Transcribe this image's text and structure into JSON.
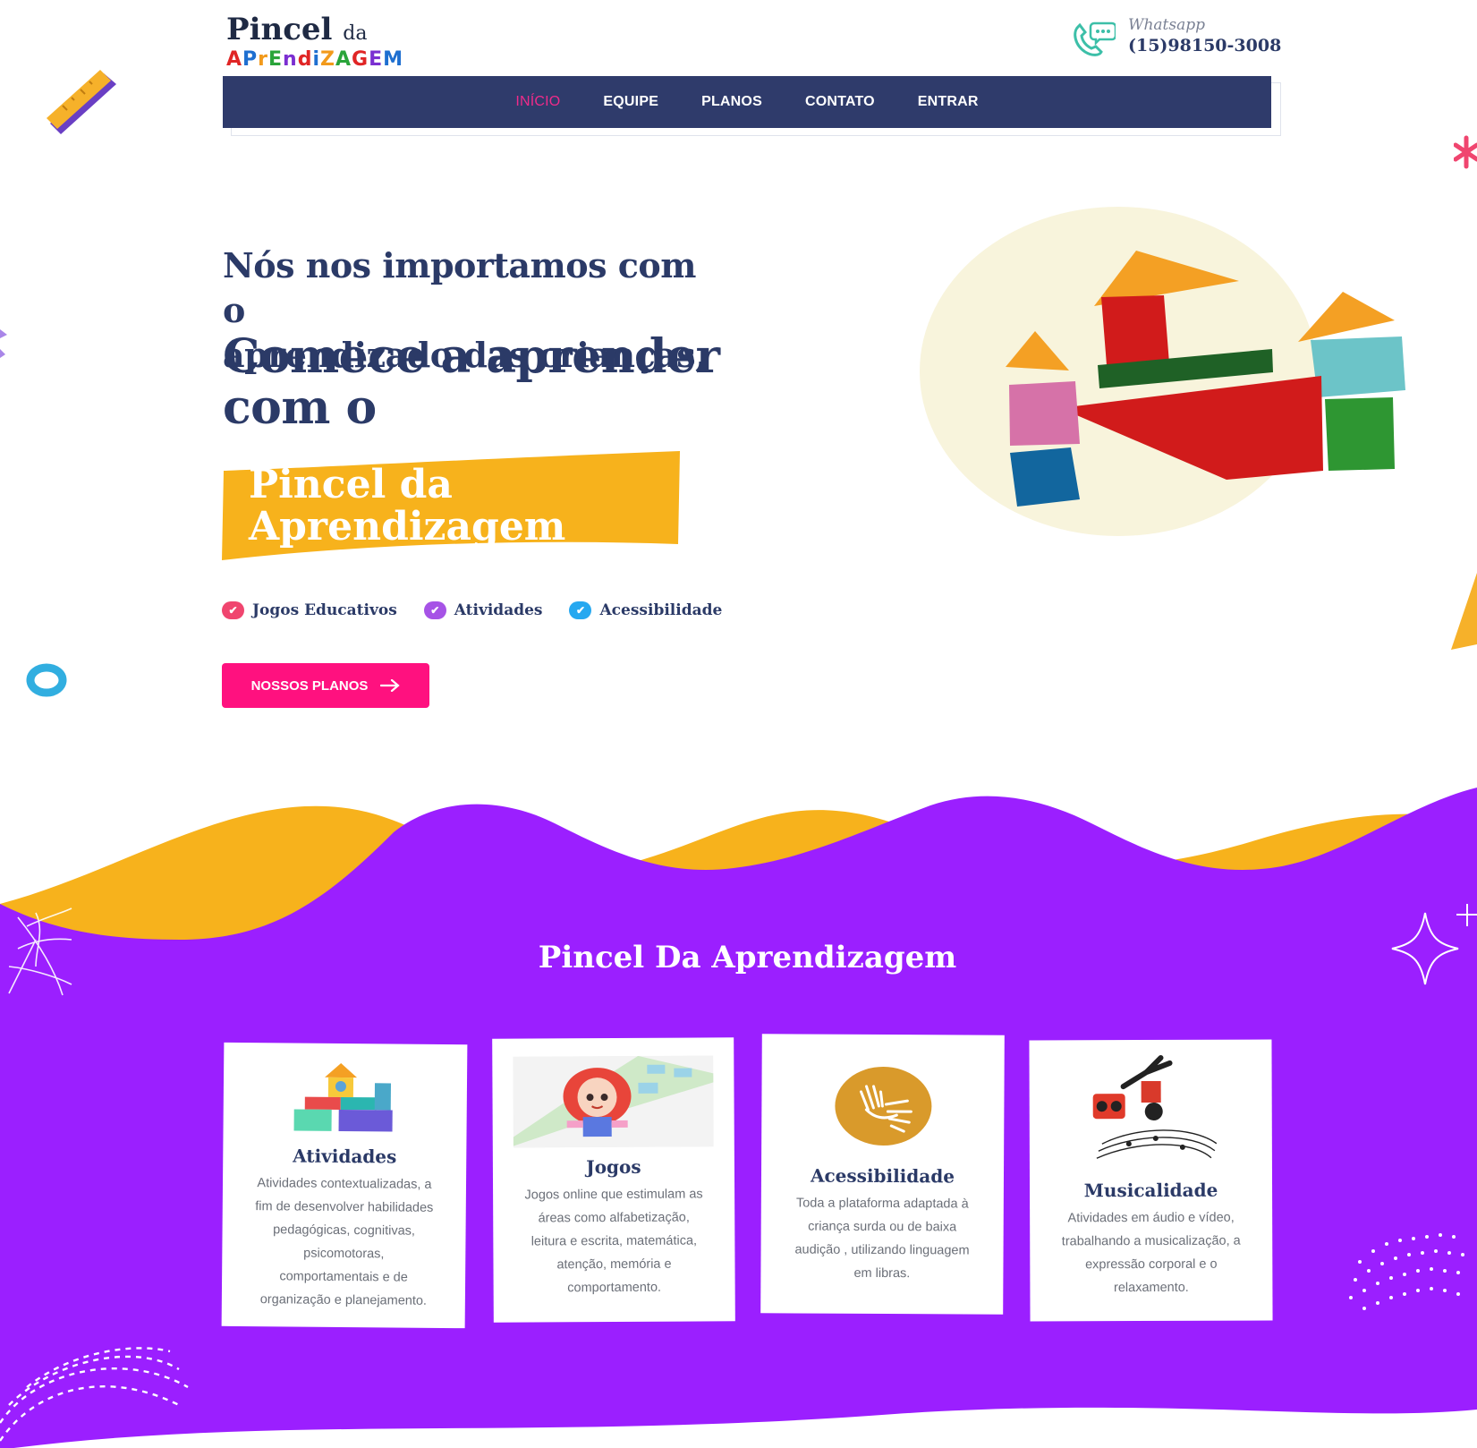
{
  "header": {
    "logo": {
      "line1": "Pincel",
      "line1_small": "da",
      "line2_letters": [
        "A",
        "P",
        "r",
        "E",
        "n",
        "d",
        "i",
        "Z",
        "A",
        "G",
        "E",
        "M"
      ],
      "colors": [
        "#e02525",
        "#1e6fd0",
        "#f29a1b",
        "#2aa43a",
        "#7b2fd1",
        "#e02525",
        "#1e6fd0",
        "#f29a1b",
        "#2aa43a",
        "#e02525",
        "#7b2fd1",
        "#1e6fd0"
      ]
    },
    "whatsapp": {
      "label": "Whatsapp",
      "phone": "(15)98150-3008",
      "icon": "whatsapp-phone-icon"
    }
  },
  "nav": {
    "items": [
      {
        "label": "INÍCIO",
        "active": true
      },
      {
        "label": "EQUIPE",
        "active": false
      },
      {
        "label": "PLANOS",
        "active": false
      },
      {
        "label": "CONTATO",
        "active": false
      },
      {
        "label": "ENTRAR",
        "active": false
      }
    ],
    "background": "#2f3b6b",
    "active_color": "#ef2b8a"
  },
  "hero": {
    "subtitle_line1": "Nós nos importamos com o",
    "subtitle_line2": "aprendizado das crianças,",
    "title_line1": "Comece a aprender",
    "title_line2": "com o",
    "highlight_line1": "Pincel da",
    "highlight_line2": "Aprendizagem",
    "highlight_color": "#f7b21c",
    "features": [
      {
        "label": "Jogos Educativos",
        "color": "#f0456f"
      },
      {
        "label": "Atividades",
        "color": "#a653e6"
      },
      {
        "label": "Acessibilidade",
        "color": "#26a8f0"
      }
    ],
    "cta": {
      "label": "NOSSOS PLANOS",
      "icon": "arrow-right-icon",
      "color": "#ff117f"
    }
  },
  "section": {
    "title": "Pincel Da Aprendizagem",
    "background": "#9b1fff",
    "wave_accent": "#f7b21c",
    "cards": [
      {
        "title": "Atividades",
        "desc_lines": [
          "Atividades contextualizadas, a",
          "fim de desenvolver habilidades",
          "pedagógicas, cognitivas,",
          "psicomotoras,",
          "comportamentais e de",
          "organização e planejamento."
        ],
        "icon": "toy-blocks-icon"
      },
      {
        "title": "Jogos",
        "desc_lines": [
          "Jogos online que estimulam as",
          "áreas como alfabetização,",
          "leitura e escrita, matemática,",
          "atenção, memória e",
          "comportamento."
        ],
        "icon": "girl-hopscotch-icon"
      },
      {
        "title": "Acessibilidade",
        "desc_lines": [
          "Toda a plataforma adaptada à",
          "criança surda ou de baixa",
          "audição , utilizando linguagem",
          "em libras."
        ],
        "icon": "sign-language-hands-icon"
      },
      {
        "title": "Musicalidade",
        "desc_lines": [
          "Atividades em áudio e vídeo,",
          "trabalhando a musicalização, a",
          "expressão corporal e o",
          "relaxamento."
        ],
        "icon": "breakdancer-music-icon"
      }
    ]
  }
}
